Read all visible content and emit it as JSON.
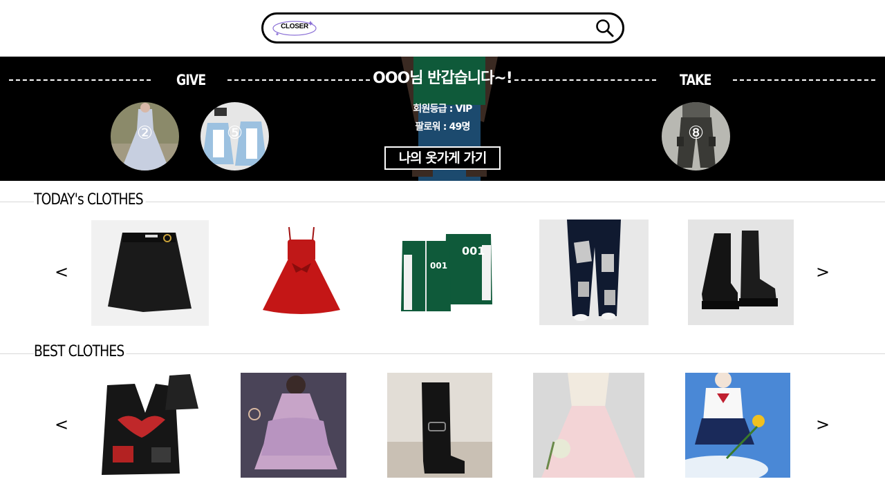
{
  "header": {
    "logo_text": "CLOSER",
    "search_placeholder": ""
  },
  "banner": {
    "give_label": "GIVE",
    "take_label": "TAKE",
    "greeting": "OOO님 반갑습니다~!",
    "member_grade": "회원등급 : VIP",
    "followers": "팔로워 : 49명",
    "store_button": "나의 옷가게 가기",
    "give_items": [
      {
        "badge": "②",
        "icon": "dress-photo"
      },
      {
        "badge": "⑤",
        "icon": "maid-outfit-photo"
      }
    ],
    "take_items": [
      {
        "badge": "⑧",
        "icon": "cargo-pants-photo"
      }
    ]
  },
  "today": {
    "title": "TODAY's CLOTHES",
    "prev": "<",
    "next": ">",
    "items": [
      {
        "name": "black-skirt"
      },
      {
        "name": "red-dress"
      },
      {
        "name": "green-tracksuit"
      },
      {
        "name": "patched-jeans"
      },
      {
        "name": "black-boots"
      }
    ],
    "jacket_number": "001"
  },
  "best": {
    "title": "BEST CLOTHES",
    "prev": "<",
    "next": ">",
    "items": [
      {
        "name": "leather-vest"
      },
      {
        "name": "pink-lolita-dress"
      },
      {
        "name": "knee-high-boots"
      },
      {
        "name": "hanbok"
      },
      {
        "name": "sailor-uniform"
      }
    ]
  },
  "colors": {
    "banner_bg": "#000000",
    "accent_purple": "#8a6fd6"
  }
}
